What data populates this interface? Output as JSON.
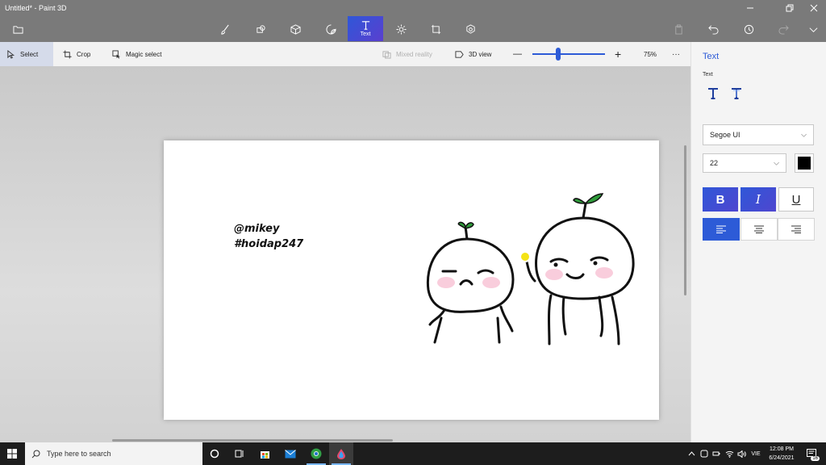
{
  "window": {
    "title": "Untitled* - Paint 3D"
  },
  "toolbar": {
    "active_tool_label": "Text",
    "tools": [
      "brushes",
      "2D shapes",
      "3D shapes",
      "stickers",
      "Text",
      "effects",
      "canvas",
      "3D library"
    ]
  },
  "subbar": {
    "select_label": "Select",
    "crop_label": "Crop",
    "magic_select_label": "Magic select",
    "mixed_reality_label": "Mixed reality",
    "view3d_label": "3D view",
    "zoom_out_symbol": "—",
    "zoom_in_symbol": "+",
    "zoom_value": "75%",
    "zoom_fraction": 0.35,
    "more_symbol": "···"
  },
  "canvas": {
    "text_line1": "@mikey",
    "text_line2": "#hoidap247"
  },
  "panel": {
    "title": "Text",
    "subtitle": "Text",
    "font_name": "Segoe UI",
    "font_size": "22",
    "color": "#000000",
    "bold_label": "B",
    "italic_label": "I",
    "underline_label": "U",
    "active_alignment": "left"
  },
  "taskbar": {
    "search_placeholder": "Type here to search",
    "language": "VIE",
    "time": "12:08 PM",
    "date": "6/24/2021",
    "notification_count": "16"
  },
  "colors": {
    "accent": "#2d5bd7",
    "titlebar": "#7a7a7a",
    "taskbar": "#1d1d1d"
  }
}
